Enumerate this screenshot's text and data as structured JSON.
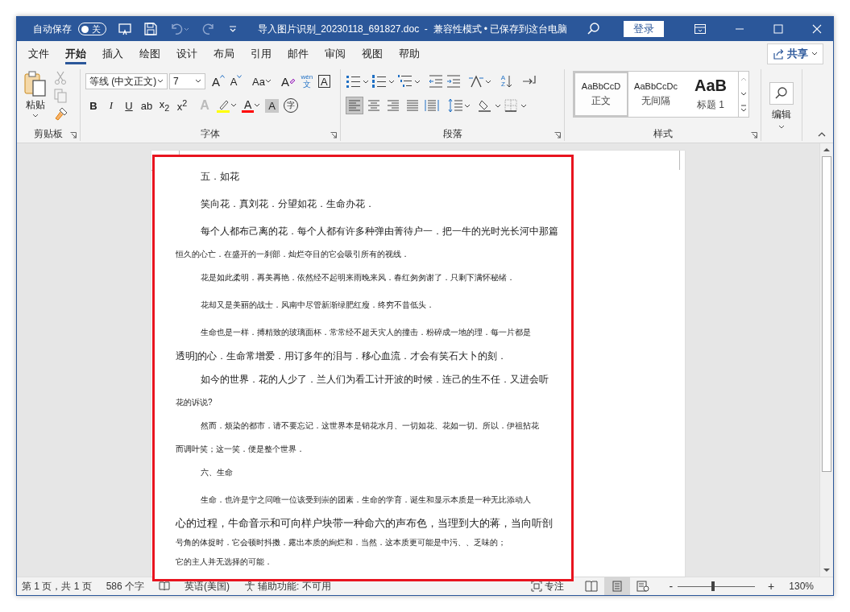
{
  "title_bar": {
    "autosave_label": "自动保存",
    "autosave": {
      "on": false,
      "label": "关"
    },
    "title": "导入图片识别_20230118_691827.doc  -  兼容性模式 • 已保存到这台电脑",
    "sign_in": "登录"
  },
  "tabs": [
    {
      "label": "文件",
      "selected": false
    },
    {
      "label": "开始",
      "selected": true
    },
    {
      "label": "插入",
      "selected": false
    },
    {
      "label": "绘图",
      "selected": false
    },
    {
      "label": "设计",
      "selected": false
    },
    {
      "label": "布局",
      "selected": false
    },
    {
      "label": "引用",
      "selected": false
    },
    {
      "label": "邮件",
      "selected": false
    },
    {
      "label": "审阅",
      "selected": false
    },
    {
      "label": "视图",
      "selected": false
    },
    {
      "label": "帮助",
      "selected": false
    }
  ],
  "share": "共享",
  "clipboard": {
    "paste": "粘贴",
    "group": "剪贴板"
  },
  "font": {
    "name": "等线 (中文正文)",
    "size": "7",
    "group": "字体",
    "row1": [
      {
        "kind": "grow",
        "label": "A"
      },
      {
        "kind": "shrink",
        "label": "A"
      },
      {
        "kind": "case",
        "label": "Aa"
      },
      {
        "kind": "clear",
        "label": "A"
      },
      {
        "kind": "phonetic",
        "label": "wén",
        "sub": "文"
      },
      {
        "kind": "border",
        "label": "A"
      }
    ],
    "row2": [
      {
        "kind": "bold",
        "label": "B"
      },
      {
        "kind": "italic",
        "label": "I"
      },
      {
        "kind": "underline",
        "label": "U"
      },
      {
        "kind": "strike",
        "label": "ab"
      },
      {
        "kind": "subscript",
        "label": "x$_{2}$"
      },
      {
        "kind": "superscript",
        "label": "x$^{2}$"
      },
      {
        "kind": "effects",
        "label": "A"
      },
      {
        "kind": "highlight",
        "color": "#ffff00"
      },
      {
        "kind": "color",
        "label": "A",
        "color": "#ff0000"
      },
      {
        "kind": "shading",
        "label": "A"
      },
      {
        "kind": "enclose",
        "label": "字"
      }
    ]
  },
  "paragraph": {
    "group": "段落",
    "sort": {
      "top": "A",
      "bottom": "Z"
    },
    "alignments": [
      {
        "kind": "left",
        "selected": true
      },
      {
        "kind": "center",
        "selected": false
      },
      {
        "kind": "right",
        "selected": false
      },
      {
        "kind": "justify",
        "selected": false
      },
      {
        "kind": "distributed",
        "selected": false
      }
    ]
  },
  "styles": {
    "group": "样式",
    "items": [
      {
        "kind": "normal",
        "preview": "AaBbCcD",
        "name": "正文",
        "selected": true
      },
      {
        "kind": "normal",
        "preview": "AaBbCcDc",
        "name": "无间隔",
        "selected": false
      },
      {
        "kind": "heading",
        "preview": "AaB",
        "name": "标题 1",
        "selected": false
      }
    ]
  },
  "editing": {
    "label": "编辑"
  },
  "document": {
    "lines": [
      {
        "kind": "lead-medium",
        "text": "五．如花"
      },
      {
        "kind": "lead-medium",
        "text": "笑向花．真刘花．分望如花．生命办花．"
      },
      {
        "kind": "lead-medium",
        "text": "每个人都布己离的花．每个人都有许多种弹由菁待户一．把一牛的光时光长河中那篇"
      },
      {
        "kind": "cont-small",
        "text": "恒久的心亡．在盛开的一刹部．灿烂夺目的它会吸引所有的视线．"
      },
      {
        "kind": "lead-small",
        "text": "花是如此柔明．再美再艳．依然经不起明来雨晚来风．春红匆匆谢了．只剩下满怀秘绪．"
      },
      {
        "kind": "lead-small",
        "text": "花却又是美丽的战士．风南中尽管新渐绿肥红瘦．终穷不昔低头．"
      },
      {
        "kind": "lead-small",
        "text": "生命也是一样．搏精致的玻璃面杯．常常经不超天灾人的撞击．粉碎成一地的理．每一片都是"
      },
      {
        "kind": "cont-medium",
        "text": "透明]的心．生命常增爱．用订多年的泪与．移心血流．才会有笑石大卜的刻．"
      },
      {
        "kind": "lead-medium",
        "text": "如今的世界．花的人少了．兰人们为看工计开波的时候．连己的生不任．又进会听"
      },
      {
        "kind": "cont-tiny",
        "text": "花的诉说?"
      },
      {
        "kind": "lead-small",
        "text": "然而．烦染的都市．请不要忘记．这世界本是销花水月、一切如花、花如一切。所以．伊祖拈花"
      },
      {
        "kind": "cont-small",
        "text": "而调叶笑；这一笑．便是整个世界．"
      },
      {
        "kind": "lead-small",
        "text": "六、生命"
      },
      {
        "kind": "lead-small",
        "text": "生命．也许是宁之问唯一位该受到崇的团素．生命的学育．诞生和显示本质是一种无比添动人"
      },
      {
        "kind": "cont-large",
        "text": "心的过程，牛命音示和可向样户块带一种命六的声布色，当理到大的蒋，当向听剖"
      },
      {
        "kind": "cont-small",
        "text": "号角的体捉时．它会顿时抖擞．露出本质的絢烂和．当然．这本质更可能是中污、、乏味的；"
      },
      {
        "kind": "cont-small",
        "text": "它的主人并无选择的可能．"
      }
    ]
  },
  "status_bar": {
    "page": "第 1 页，共 1 页",
    "words": "586 个字",
    "language": "英语(美国)",
    "accessibility": "辅助功能: 不可用",
    "focus": "专注",
    "views": [
      {
        "kind": "read",
        "selected": false
      },
      {
        "kind": "print",
        "selected": true
      },
      {
        "kind": "web",
        "selected": false
      }
    ],
    "zoom_out": "-",
    "zoom_in": "+",
    "zoom": {
      "level": 0.46
    },
    "zoom_value": "130%"
  }
}
